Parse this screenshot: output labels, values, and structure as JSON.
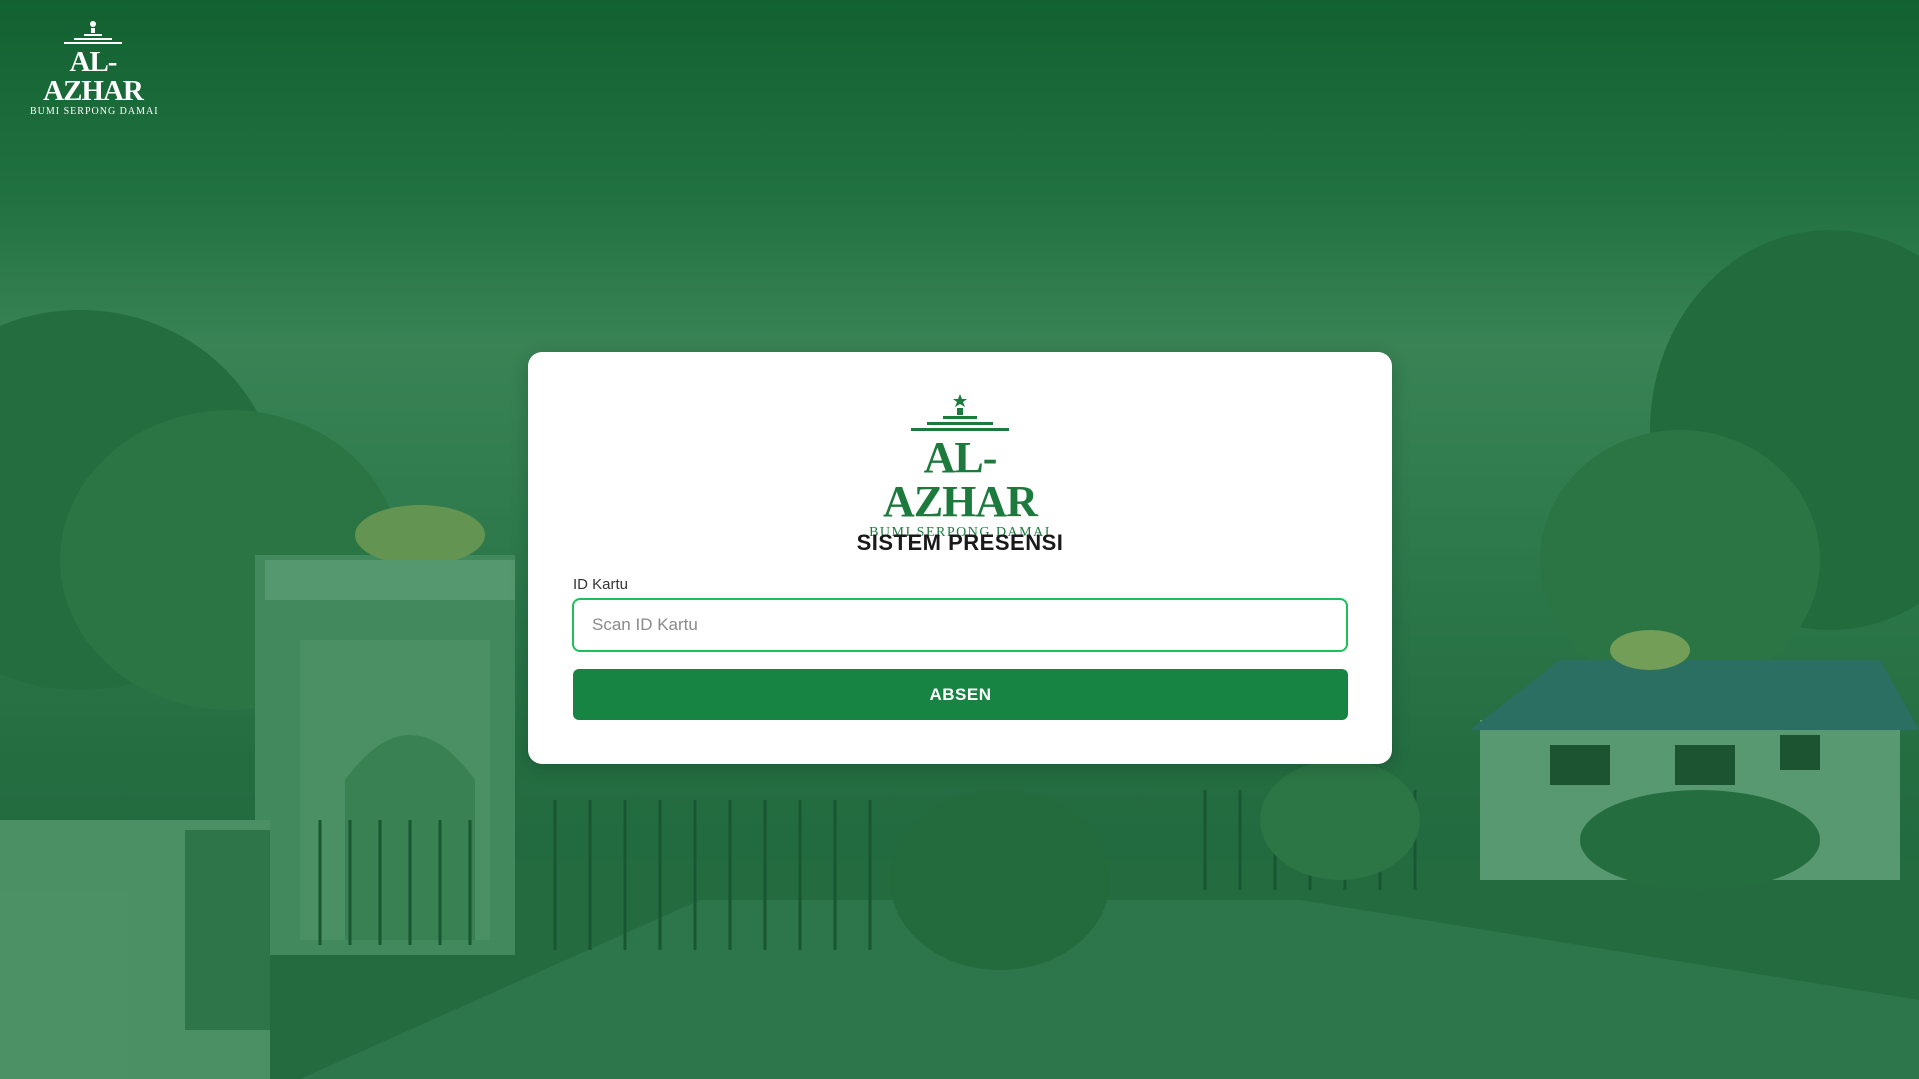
{
  "brand": {
    "name": "AL-AZHAR",
    "subtitle": "BUMI SERPONG DAMAI"
  },
  "form": {
    "title": "SISTEM PRESENSI",
    "id_label": "ID Kartu",
    "id_placeholder": "Scan ID Kartu",
    "id_value": "",
    "submit_label": "ABSEN"
  },
  "colors": {
    "brand_green": "#178443",
    "focus_border": "#1fbf5c",
    "background_tint": "#2f6e48"
  },
  "icons": {
    "logo_emblem": "crescent-star-mosque-roof-icon"
  }
}
